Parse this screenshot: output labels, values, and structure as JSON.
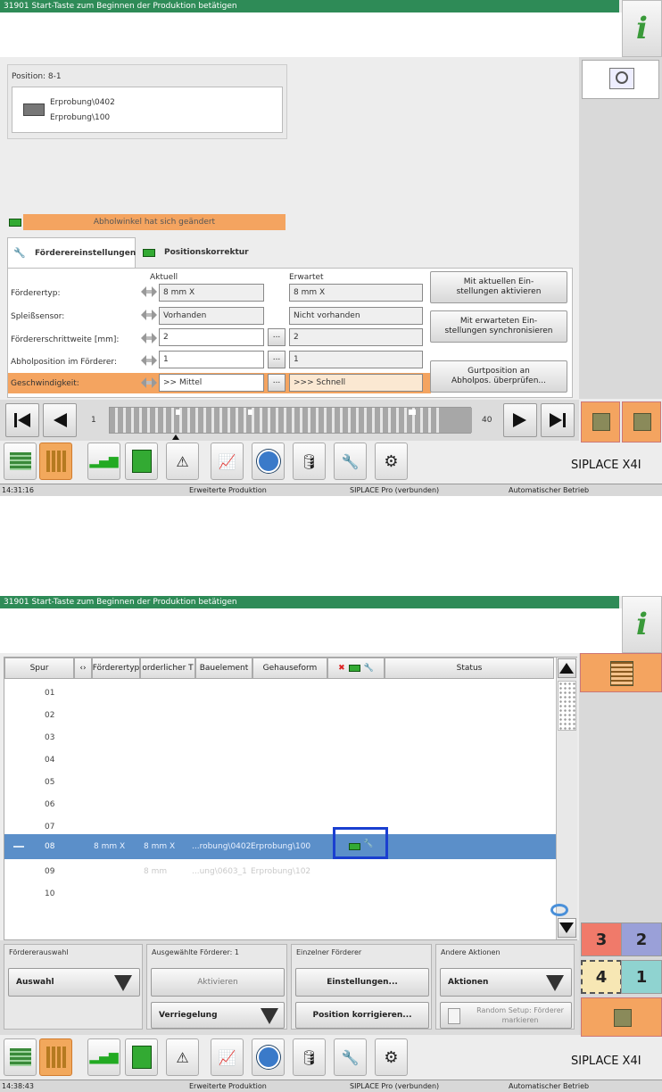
{
  "shared": {
    "title": "31901 Start-Taste zum Beginnen der Produktion betätigen",
    "brand": "SIPLACE X4I",
    "status_mode": "Erweiterte Produktion",
    "status_conn": "SIPLACE Pro (verbunden)",
    "status_op": "Automatischer Betrieb",
    "accent_green": "#2e8b57",
    "accent_orange": "#f4a460",
    "selection_blue": "#5b8fc9"
  },
  "screen1": {
    "time": "14:31:16",
    "position_label": "Position: 8-1",
    "component_line1": "Erprobung\\0402",
    "component_line2": "Erprobung\\100",
    "warning": "Abholwinkel hat sich geändert",
    "tab1": "Förderereinstellungen",
    "tab2": "Positionskorrektur",
    "col_current": "Aktuell",
    "col_expected": "Erwartet",
    "rows": [
      {
        "label": "Förderertyp:",
        "current": "8 mm X",
        "expected": "8 mm X"
      },
      {
        "label": "Spleißsensor:",
        "current": "Vorhanden",
        "expected": "Nicht vorhanden"
      },
      {
        "label": "Fördererschrittweite [mm]:",
        "current": "2",
        "expected": "2"
      },
      {
        "label": "Abholposition im Förderer:",
        "current": "1",
        "expected": "1"
      },
      {
        "label": "Geschwindigkeit:",
        "current": ">> Mittel",
        "expected": ">>> Schnell"
      }
    ],
    "dots": "...",
    "btn_activate": "Mit aktuellen Ein-stellungen aktivieren",
    "btn_sync": "Mit erwarteten Ein-stellungen synchronisieren",
    "btn_check": "Gurtposition an Abholpos. überprüfen...",
    "slider_start": "1",
    "slider_end": "40"
  },
  "screen2": {
    "time": "14:38:43",
    "headers": {
      "spur": "Spur",
      "feeder_type": "Förderertyp",
      "required": "orderlicher T",
      "component": "Bauelement",
      "package": "Gehauseform",
      "status": "Status"
    },
    "rows": [
      "01",
      "02",
      "03",
      "04",
      "05",
      "06",
      "07",
      "08",
      "09",
      "10"
    ],
    "selected_row": {
      "spur": "08",
      "type": "8 mm X",
      "req": "8 mm X",
      "component": "...robung\\0402",
      "package": "Erprobung\\100"
    },
    "row09": {
      "req": "8 mm",
      "component": "...ung\\0603_1",
      "package": "Erprobung\\102"
    },
    "group1_title": "Fördererauswahl",
    "group1_dropdown": "Auswahl",
    "group2_title": "Ausgewählte Förderer: 1",
    "group2_btn": "Aktivieren",
    "group2_dropdown": "Verriegelung",
    "group3_title": "Einzelner Förderer",
    "group3_btn1": "Einstellungen...",
    "group3_btn2": "Position korrigieren...",
    "group4_title": "Andere Aktionen",
    "group4_dropdown": "Aktionen",
    "group4_btn": "Random Setup: Förderer markieren",
    "tiles": [
      "3",
      "2",
      "4",
      "1"
    ]
  }
}
